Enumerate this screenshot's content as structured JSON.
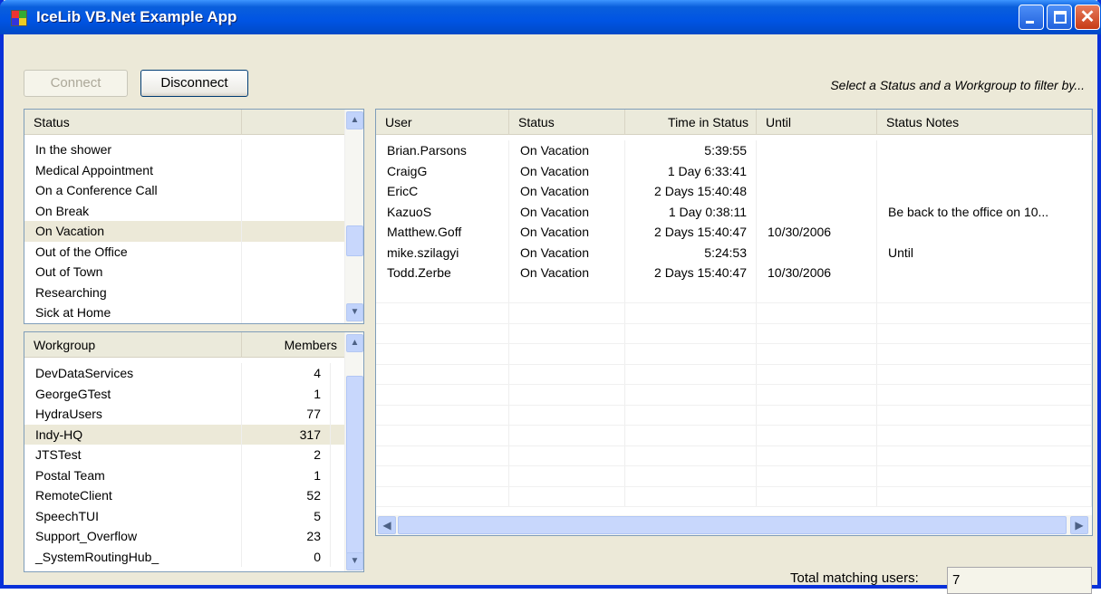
{
  "window": {
    "title": "IceLib VB.Net Example App"
  },
  "toolbar": {
    "connect_label": "Connect",
    "disconnect_label": "Disconnect",
    "filter_hint": "Select a Status and a Workgroup to filter by..."
  },
  "status_list": {
    "headers": [
      "Status",
      ""
    ],
    "items": [
      "In the shower",
      "Medical Appointment",
      "On a Conference Call",
      "On Break",
      "On Vacation",
      "Out of the Office",
      "Out of Town",
      "Researching",
      "Sick at Home"
    ],
    "selected": "On Vacation"
  },
  "workgroup_list": {
    "headers": [
      "Workgroup",
      "Members"
    ],
    "items": [
      {
        "name": "DevDataServices",
        "members": "4"
      },
      {
        "name": "GeorgeGTest",
        "members": "1"
      },
      {
        "name": "HydraUsers",
        "members": "77"
      },
      {
        "name": "Indy-HQ",
        "members": "317"
      },
      {
        "name": "JTSTest",
        "members": "2"
      },
      {
        "name": "Postal Team",
        "members": "1"
      },
      {
        "name": "RemoteClient",
        "members": "52"
      },
      {
        "name": "SpeechTUI",
        "members": "5"
      },
      {
        "name": "Support_Overflow",
        "members": "23"
      },
      {
        "name": "_SystemRoutingHub_",
        "members": "0"
      }
    ],
    "selected": "Indy-HQ"
  },
  "users_table": {
    "headers": [
      "User",
      "Status",
      "Time in Status",
      "Until",
      "Status Notes"
    ],
    "rows": [
      [
        "Brian.Parsons",
        "On Vacation",
        "5:39:55",
        "",
        ""
      ],
      [
        "CraigG",
        "On Vacation",
        "1 Day 6:33:41",
        "",
        ""
      ],
      [
        "EricC",
        "On Vacation",
        "2 Days 15:40:48",
        "",
        ""
      ],
      [
        "KazuoS",
        "On Vacation",
        "1 Day 0:38:11",
        "",
        "Be back to the office on 10..."
      ],
      [
        "Matthew.Goff",
        "On Vacation",
        "2 Days 15:40:47",
        "10/30/2006",
        ""
      ],
      [
        "mike.szilagyi",
        "On Vacation",
        "5:24:53",
        "",
        "Until"
      ],
      [
        "Todd.Zerbe",
        "On Vacation",
        "2 Days 15:40:47",
        "10/30/2006",
        ""
      ]
    ]
  },
  "footer": {
    "total_label": "Total matching users:",
    "total_value": "7"
  }
}
